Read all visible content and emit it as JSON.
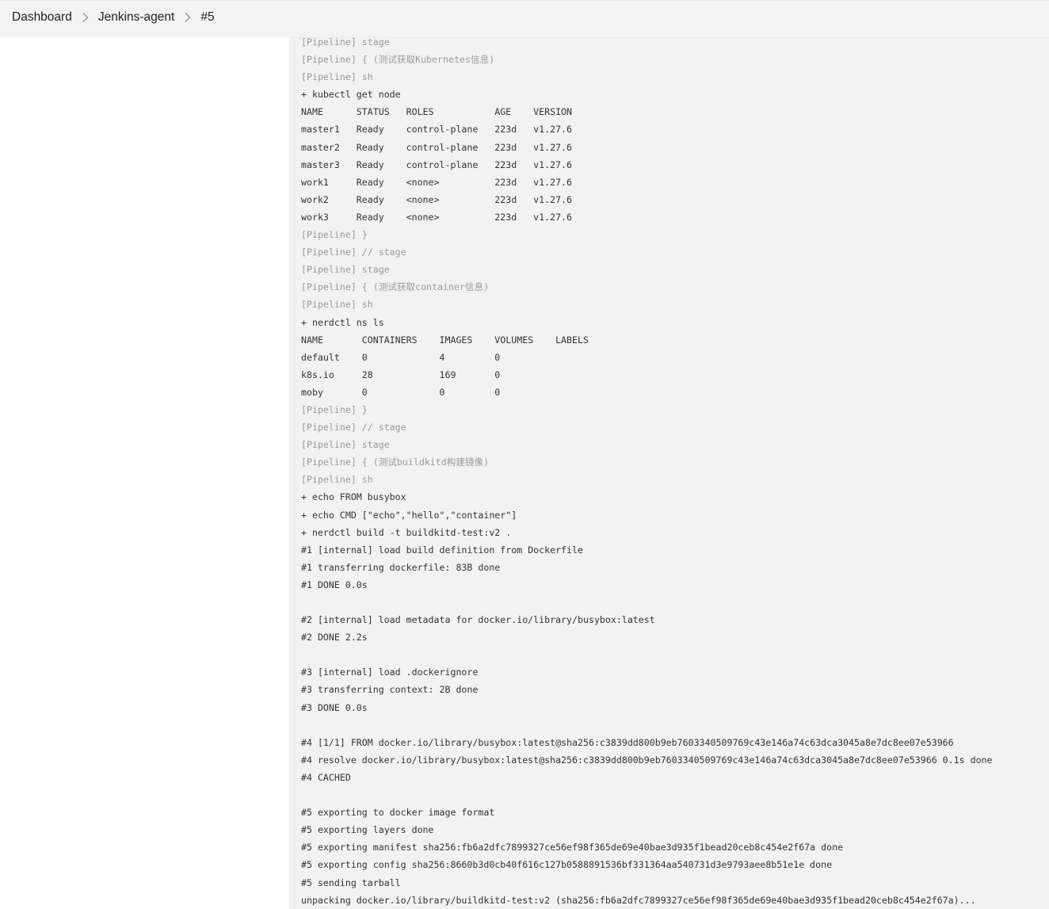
{
  "breadcrumb": {
    "items": [
      "Dashboard",
      "Jenkins-agent",
      "#5"
    ]
  },
  "colors": {
    "console_bg": "#f2f2f2",
    "pipeline_text": "#9a9a9a",
    "output_text": "#333333"
  },
  "console": {
    "lines": [
      {
        "kind": "pipeline",
        "text": "[Pipeline] stage"
      },
      {
        "kind": "pipeline",
        "text": "[Pipeline] { (测试获取Kubernetes信息)"
      },
      {
        "kind": "pipeline",
        "text": "[Pipeline] sh"
      },
      {
        "kind": "output",
        "text": "+ kubectl get node"
      },
      {
        "kind": "output",
        "text": "NAME      STATUS   ROLES           AGE    VERSION"
      },
      {
        "kind": "output",
        "text": "master1   Ready    control-plane   223d   v1.27.6"
      },
      {
        "kind": "output",
        "text": "master2   Ready    control-plane   223d   v1.27.6"
      },
      {
        "kind": "output",
        "text": "master3   Ready    control-plane   223d   v1.27.6"
      },
      {
        "kind": "output",
        "text": "work1     Ready    <none>          223d   v1.27.6"
      },
      {
        "kind": "output",
        "text": "work2     Ready    <none>          223d   v1.27.6"
      },
      {
        "kind": "output",
        "text": "work3     Ready    <none>          223d   v1.27.6"
      },
      {
        "kind": "pipeline",
        "text": "[Pipeline] }"
      },
      {
        "kind": "pipeline",
        "text": "[Pipeline] // stage"
      },
      {
        "kind": "pipeline",
        "text": "[Pipeline] stage"
      },
      {
        "kind": "pipeline",
        "text": "[Pipeline] { (测试获取container信息)"
      },
      {
        "kind": "pipeline",
        "text": "[Pipeline] sh"
      },
      {
        "kind": "output",
        "text": "+ nerdctl ns ls"
      },
      {
        "kind": "output",
        "text": "NAME       CONTAINERS    IMAGES    VOLUMES    LABELS"
      },
      {
        "kind": "output",
        "text": "default    0             4         0"
      },
      {
        "kind": "output",
        "text": "k8s.io     28            169       0"
      },
      {
        "kind": "output",
        "text": "moby       0             0         0"
      },
      {
        "kind": "pipeline",
        "text": "[Pipeline] }"
      },
      {
        "kind": "pipeline",
        "text": "[Pipeline] // stage"
      },
      {
        "kind": "pipeline",
        "text": "[Pipeline] stage"
      },
      {
        "kind": "pipeline",
        "text": "[Pipeline] { (测试buildkitd构建镜像)"
      },
      {
        "kind": "pipeline",
        "text": "[Pipeline] sh"
      },
      {
        "kind": "output",
        "text": "+ echo FROM busybox"
      },
      {
        "kind": "output",
        "text": "+ echo CMD [\"echo\",\"hello\",\"container\"]"
      },
      {
        "kind": "output",
        "text": "+ nerdctl build -t buildkitd-test:v2 ."
      },
      {
        "kind": "output",
        "text": "#1 [internal] load build definition from Dockerfile"
      },
      {
        "kind": "output",
        "text": "#1 transferring dockerfile: 83B done"
      },
      {
        "kind": "output",
        "text": "#1 DONE 0.0s"
      },
      {
        "kind": "output",
        "text": ""
      },
      {
        "kind": "output",
        "text": "#2 [internal] load metadata for docker.io/library/busybox:latest"
      },
      {
        "kind": "output",
        "text": "#2 DONE 2.2s"
      },
      {
        "kind": "output",
        "text": ""
      },
      {
        "kind": "output",
        "text": "#3 [internal] load .dockerignore"
      },
      {
        "kind": "output",
        "text": "#3 transferring context: 2B done"
      },
      {
        "kind": "output",
        "text": "#3 DONE 0.0s"
      },
      {
        "kind": "output",
        "text": ""
      },
      {
        "kind": "output",
        "text": "#4 [1/1] FROM docker.io/library/busybox:latest@sha256:c3839dd800b9eb7603340509769c43e146a74c63dca3045a8e7dc8ee07e53966"
      },
      {
        "kind": "output",
        "text": "#4 resolve docker.io/library/busybox:latest@sha256:c3839dd800b9eb7603340509769c43e146a74c63dca3045a8e7dc8ee07e53966 0.1s done"
      },
      {
        "kind": "output",
        "text": "#4 CACHED"
      },
      {
        "kind": "output",
        "text": ""
      },
      {
        "kind": "output",
        "text": "#5 exporting to docker image format"
      },
      {
        "kind": "output",
        "text": "#5 exporting layers done"
      },
      {
        "kind": "output",
        "text": "#5 exporting manifest sha256:fb6a2dfc7899327ce56ef98f365de69e40bae3d935f1bead20ceb8c454e2f67a done"
      },
      {
        "kind": "output",
        "text": "#5 exporting config sha256:8660b3d0cb40f616c127b0588891536bf331364aa540731d3e9793aee8b51e1e done"
      },
      {
        "kind": "output",
        "text": "#5 sending tarball"
      },
      {
        "kind": "output",
        "text": "unpacking docker.io/library/buildkitd-test:v2 (sha256:fb6a2dfc7899327ce56ef98f365de69e40bae3d935f1bead20ceb8c454e2f67a)..."
      }
    ]
  }
}
